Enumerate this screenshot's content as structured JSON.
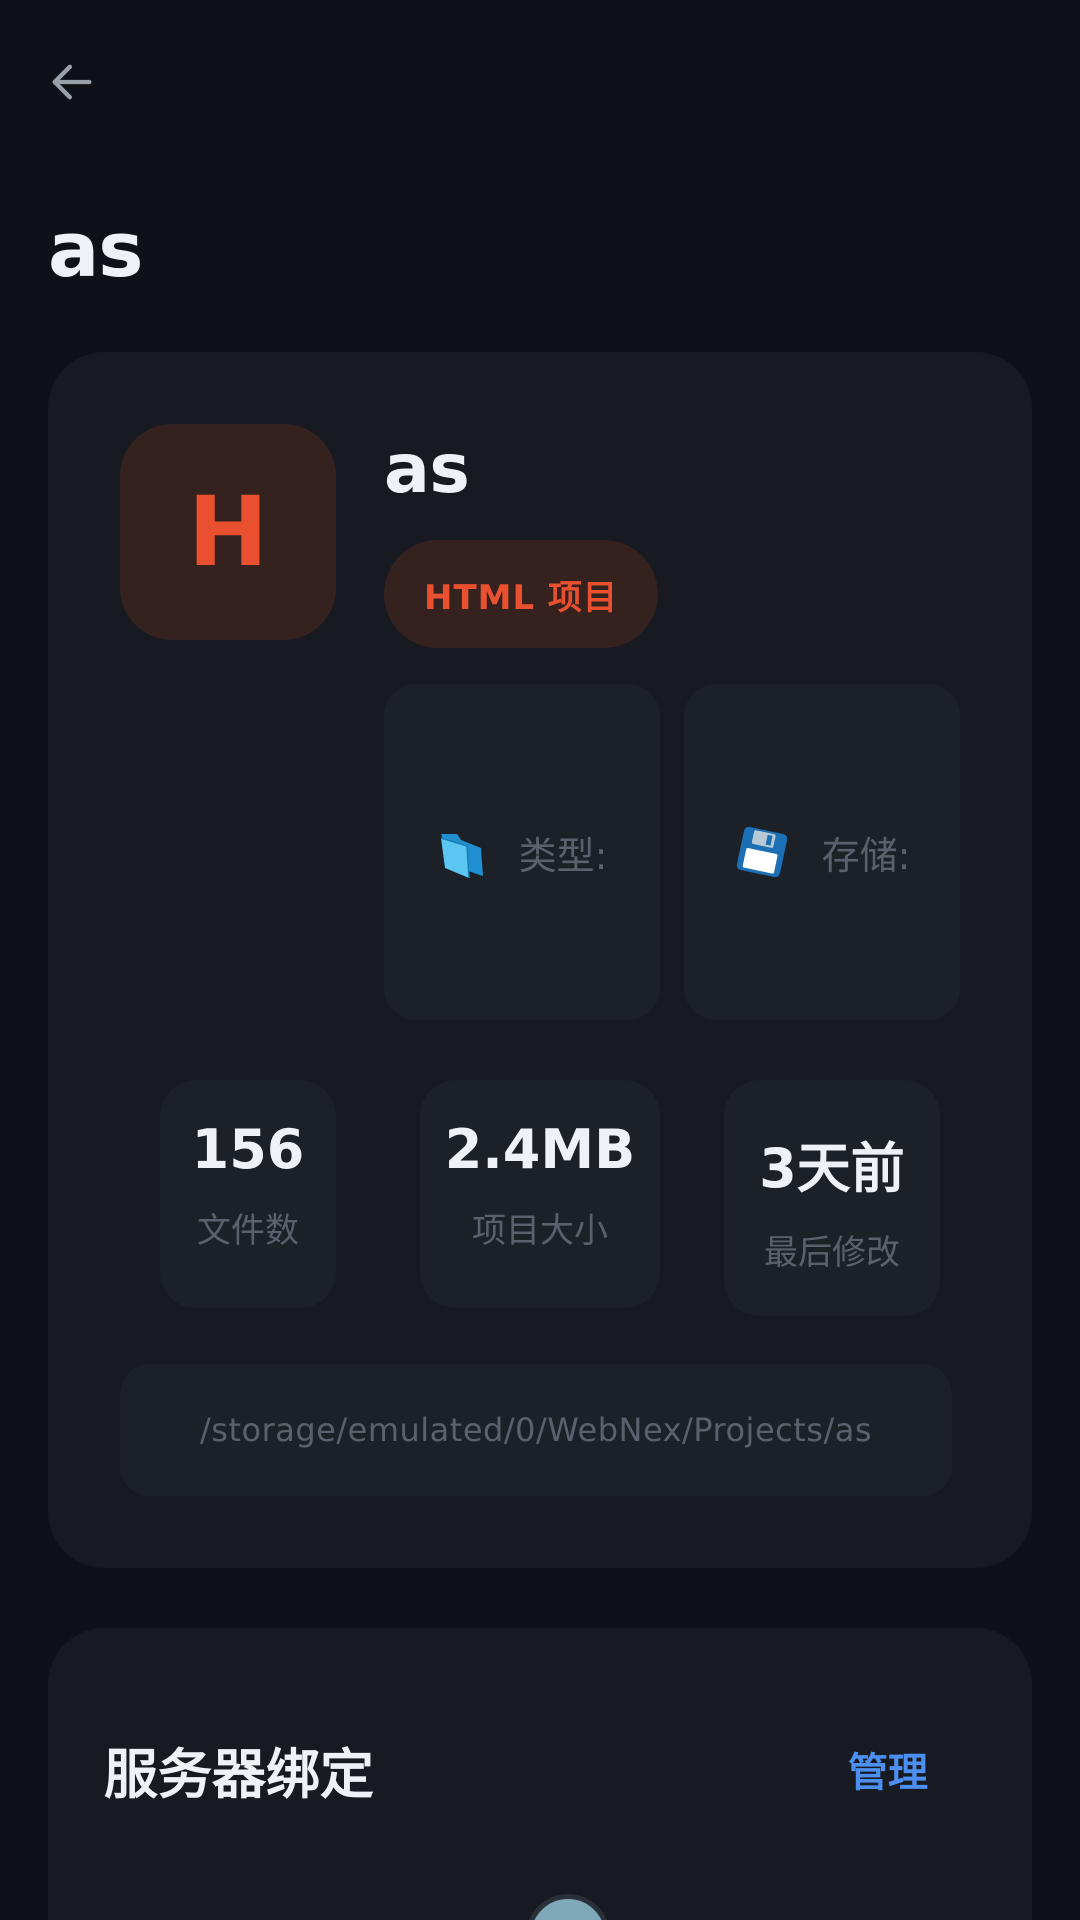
{
  "header": {
    "back_icon": "arrow-left-icon",
    "title": "as"
  },
  "project": {
    "avatar_letter": "H",
    "name": "as",
    "badge": "HTML 项目",
    "type_label": "类型:",
    "type_icon": "folder-icon",
    "storage_label": "存储:",
    "storage_icon": "floppy-disk-icon",
    "stats": {
      "files_value": "156",
      "files_label": "文件数",
      "size_value": "2.4MB",
      "size_label": "项目大小",
      "modified_value": "3天前",
      "modified_label": "最后修改"
    },
    "path": "/storage/emulated/0/WebNex/Projects/as"
  },
  "server": {
    "title": "服务器绑定",
    "manage": "管理"
  },
  "colors": {
    "background": "#0e1117",
    "card": "#171a21",
    "accent_orange": "#e8502f",
    "link_blue": "#4d8ff0"
  }
}
